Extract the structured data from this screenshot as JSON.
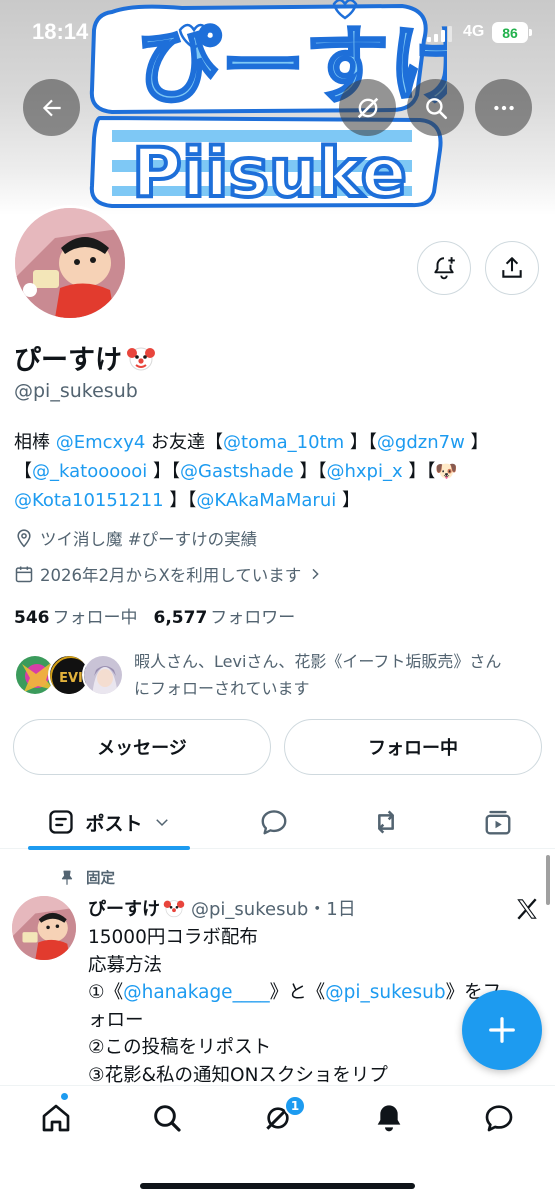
{
  "status_bar": {
    "time": "18:14",
    "network": "4G",
    "battery": "86"
  },
  "banner": {
    "logo_text_top": "ぴーすけ",
    "logo_text_bottom": "Piisuke"
  },
  "profile": {
    "display_name": "ぴーすけ",
    "handle": "@pi_sukesub",
    "bio": {
      "line1": [
        {
          "t": "相棒 ",
          "link": false
        },
        {
          "t": "@Emcxy4",
          "link": true
        },
        {
          "t": " お友達【",
          "link": false
        },
        {
          "t": "@toma_10tm",
          "link": true
        },
        {
          "t": " 】【",
          "link": false
        },
        {
          "t": "@gdzn7w",
          "link": true
        },
        {
          "t": " 】",
          "link": false
        }
      ],
      "line2": [
        {
          "t": "【",
          "link": false
        },
        {
          "t": "@_katoooooi",
          "link": true
        },
        {
          "t": " 】【",
          "link": false
        },
        {
          "t": "@Gastshade",
          "link": true
        },
        {
          "t": " 】【",
          "link": false
        },
        {
          "t": "@hxpi_x",
          "link": true
        },
        {
          "t": " 】【🐶",
          "link": false
        }
      ],
      "line3": [
        {
          "t": "@Kota10151211",
          "link": true
        },
        {
          "t": " 】【",
          "link": false
        },
        {
          "t": "@KAkaMaMarui",
          "link": true
        },
        {
          "t": " 】",
          "link": false
        }
      ]
    },
    "location": "ツイ消し魔 #ぴーすけの実績",
    "joined": "2026年2月からXを利用しています",
    "following_count": "546",
    "following_label": "フォロー中",
    "followers_count": "6,577",
    "followers_label": "フォロワー",
    "followed_by_line1": "暇人さん、Leviさん、花影《イーフト垢販売》さん",
    "followed_by_line2": "にフォローされています",
    "levi_badge": "EVI"
  },
  "actions": {
    "message_label": "メッセージ",
    "following_label": "フォロー中"
  },
  "tabs": {
    "posts_label": "ポスト"
  },
  "tweet": {
    "pinned_label": "固定",
    "author": "ぴーすけ",
    "handle_time": "@pi_sukesub・1日",
    "lines": {
      "l1": "15000円コラボ配布",
      "l2": "応募方法",
      "l3_a": "①《",
      "l3_b": "@hanakage____",
      "l3_c": "》と《",
      "l3_d": "@pi_sukesub",
      "l3_e": "》をフ",
      "l4": "ォロー",
      "l5": "②この投稿をリポスト",
      "l6": "③花影&私の通知ONスクショをリプ"
    }
  },
  "bottom_nav": {
    "grok_badge": "1"
  },
  "colors": {
    "accent": "#1d9bf0",
    "text": "#0f1419",
    "muted": "#536471",
    "border": "#cfd9de"
  },
  "icons": [
    "back-arrow-icon",
    "grok-icon",
    "search-icon",
    "more-icon",
    "notify-plus-icon",
    "share-icon",
    "location-icon",
    "calendar-icon",
    "chevron-right-icon",
    "posts-icon",
    "chevron-down-icon",
    "reply-icon",
    "repost-icon",
    "media-icon",
    "pin-icon",
    "x-logo-icon",
    "plus-icon",
    "home-icon",
    "explore-icon",
    "bell-icon",
    "messages-icon"
  ]
}
